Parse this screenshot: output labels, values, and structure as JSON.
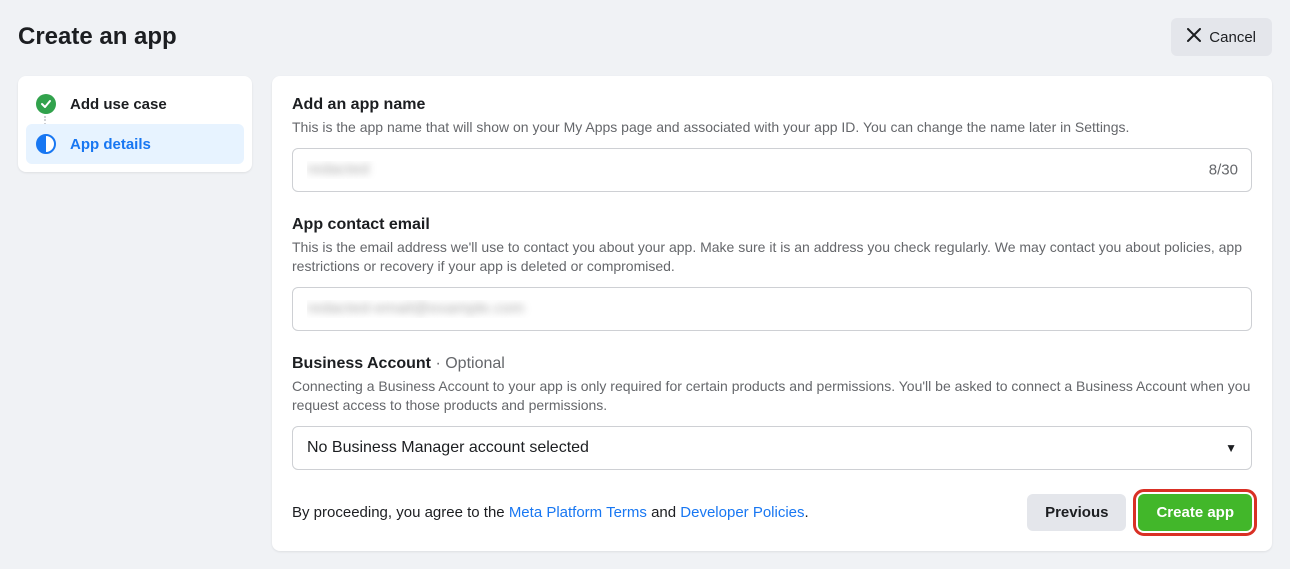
{
  "header": {
    "title": "Create an app",
    "cancel_label": "Cancel"
  },
  "sidebar": {
    "items": [
      {
        "label": "Add use case"
      },
      {
        "label": "App details"
      }
    ]
  },
  "form": {
    "app_name": {
      "label": "Add an app name",
      "description": "This is the app name that will show on your My Apps page and associated with your app ID. You can change the name later in Settings.",
      "value": "redacted",
      "counter": "8/30"
    },
    "contact_email": {
      "label": "App contact email",
      "description": "This is the email address we'll use to contact you about your app. Make sure it is an address you check regularly. We may contact you about policies, app restrictions or recovery if your app is deleted or compromised.",
      "value": "redacted-email@example.com"
    },
    "business_account": {
      "label": "Business Account",
      "optional": " · Optional",
      "description": "Connecting a Business Account to your app is only required for certain products and permissions. You'll be asked to connect a Business Account when you request access to those products and permissions.",
      "selected": "No Business Manager account selected"
    }
  },
  "footer": {
    "disclaimer_prefix": "By proceeding, you agree to the ",
    "link1": "Meta Platform Terms",
    "disclaimer_mid": " and ",
    "link2": "Developer Policies",
    "disclaimer_suffix": ".",
    "previous_label": "Previous",
    "create_label": "Create app"
  }
}
